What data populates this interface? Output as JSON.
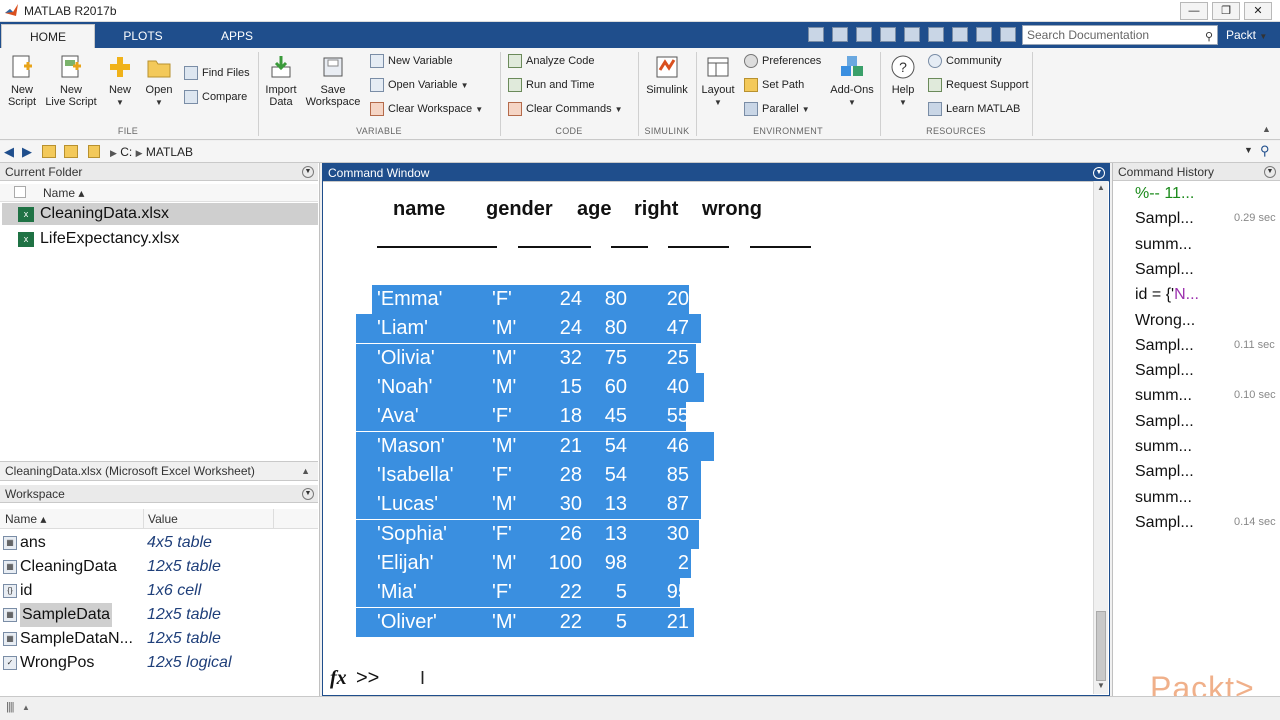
{
  "window": {
    "title": "MATLAB R2017b",
    "min": "—",
    "max": "❐",
    "close": "✕"
  },
  "tabs": [
    "HOME",
    "PLOTS",
    "APPS"
  ],
  "search": {
    "placeholder": "Search Documentation",
    "user_menu": "Packt"
  },
  "ribbon": {
    "new_script": [
      "New",
      "Script"
    ],
    "new_live_script": [
      "New",
      "Live Script"
    ],
    "new": "New",
    "open": "Open",
    "find_files": "Find Files",
    "compare": "Compare",
    "import_data": [
      "Import",
      "Data"
    ],
    "save_workspace": [
      "Save",
      "Workspace"
    ],
    "new_variable": "New Variable",
    "open_variable": "Open Variable",
    "clear_workspace": "Clear Workspace",
    "analyze_code": "Analyze Code",
    "run_and_time": "Run and Time",
    "clear_commands": "Clear Commands",
    "simulink": "Simulink",
    "layout": "Layout",
    "preferences": "Preferences",
    "set_path": "Set Path",
    "parallel": "Parallel",
    "add_ons": "Add-Ons",
    "help": "Help",
    "community": "Community",
    "request_support": "Request Support",
    "learn_matlab": "Learn MATLAB",
    "groups": [
      "FILE",
      "VARIABLE",
      "CODE",
      "SIMULINK",
      "ENVIRONMENT",
      "RESOURCES"
    ]
  },
  "address": {
    "drive": "C:",
    "folder": "MATLAB"
  },
  "current_folder": {
    "title": "Current Folder",
    "col_name": "Name ▴",
    "files": [
      {
        "name": "CleaningData.xlsx",
        "selected": true
      },
      {
        "name": "LifeExpectancy.xlsx",
        "selected": false
      }
    ],
    "details": "CleaningData.xlsx  (Microsoft Excel Worksheet)"
  },
  "workspace": {
    "title": "Workspace",
    "col_name": "Name ▴",
    "col_value": "Value",
    "vars": [
      {
        "name": "ans",
        "value": "4x5 table",
        "icon": "table-icon"
      },
      {
        "name": "CleaningData",
        "value": "12x5 table",
        "icon": "table-icon"
      },
      {
        "name": "id",
        "value": "1x6 cell",
        "icon": "cell-icon"
      },
      {
        "name": "SampleData",
        "value": "12x5 table",
        "icon": "table-icon",
        "selected": true
      },
      {
        "name": "SampleDataN...",
        "value": "12x5 table",
        "icon": "table-icon"
      },
      {
        "name": "WrongPos",
        "value": "12x5 logical",
        "icon": "logical-icon"
      }
    ]
  },
  "command_window": {
    "title": "Command Window",
    "headers": [
      "name",
      "gender",
      "age",
      "right",
      "wrong"
    ],
    "rows": [
      [
        "'Emma'",
        "'F'",
        "24",
        "80",
        "20"
      ],
      [
        "'Liam'",
        "'M'",
        "24",
        "80",
        "47"
      ],
      [
        "'Olivia'",
        "'M'",
        "32",
        "75",
        "25"
      ],
      [
        "'Noah'",
        "'M'",
        "15",
        "60",
        "40"
      ],
      [
        "'Ava'",
        "'F'",
        "18",
        "45",
        "55"
      ],
      [
        "'Mason'",
        "'M'",
        "21",
        "54",
        "46"
      ],
      [
        "'Isabella'",
        "'F'",
        "28",
        "54",
        "85"
      ],
      [
        "'Lucas'",
        "'M'",
        "30",
        "13",
        "87"
      ],
      [
        "'Sophia'",
        "'F'",
        "26",
        "13",
        "30"
      ],
      [
        "'Elijah'",
        "'M'",
        "100",
        "98",
        "2"
      ],
      [
        "'Mia'",
        "'F'",
        "22",
        "5",
        "95"
      ],
      [
        "'Oliver'",
        "'M'",
        "22",
        "5",
        "21"
      ]
    ],
    "fx": "fx",
    "prompt": ">>"
  },
  "history": {
    "title": "Command History",
    "items": [
      {
        "text": "%-- 11...",
        "time": "",
        "style": "green"
      },
      {
        "text": "Sampl...",
        "time": "0.29 sec"
      },
      {
        "text": "summ...",
        "time": ""
      },
      {
        "text": "Sampl...",
        "time": ""
      },
      {
        "text_a": "id = {'",
        "text_b": "N...",
        "time": "",
        "style": "mixed"
      },
      {
        "text": "Wrong...",
        "time": ""
      },
      {
        "text": "Sampl...",
        "time": "0.11 sec"
      },
      {
        "text": "Sampl...",
        "time": ""
      },
      {
        "text": "summ...",
        "time": "0.10 sec"
      },
      {
        "text": "Sampl...",
        "time": ""
      },
      {
        "text": "summ...",
        "time": ""
      },
      {
        "text": "Sampl...",
        "time": ""
      },
      {
        "text": "summ...",
        "time": ""
      },
      {
        "text": "Sampl...",
        "time": "0.14 sec"
      }
    ]
  },
  "watermark": "Packt>",
  "colors": {
    "accent": "#1f4e8c",
    "selection": "#3a8fe0",
    "history_green": "#1a8a1a",
    "watermark": "#f0b08a"
  }
}
